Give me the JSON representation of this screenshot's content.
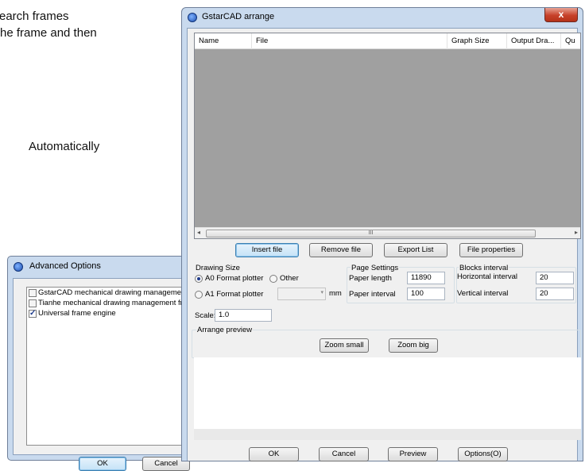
{
  "document": {
    "lines": [
      "earch frames",
      "he frame and then",
      "Automatically"
    ]
  },
  "advanced_options": {
    "title": "Advanced Options",
    "engines": [
      {
        "label": "GstarCAD mechanical drawing management",
        "checked": false
      },
      {
        "label": "Tianhe mechanical drawing management fra",
        "checked": false
      },
      {
        "label": "Universal frame engine",
        "checked": true
      }
    ],
    "ok_label": "OK",
    "cancel_label": "Cancel"
  },
  "arrange_dialog": {
    "title": "GstarCAD arrange",
    "close_label": "x",
    "columns": [
      "Name",
      "File",
      "Graph Size",
      "Output Dra...",
      "Qu"
    ],
    "scroll_thumb": "III",
    "file_buttons": {
      "insert": "Insert file",
      "remove": "Remove file",
      "export": "Export List",
      "properties": "File properties"
    },
    "drawing_size": {
      "title": "Drawing Size",
      "a0_label": "A0 Format plotter",
      "other_label": "Other",
      "a1_label": "A1 Format plotter",
      "unit": "mm",
      "selected": "A0 Format plotter"
    },
    "page_settings": {
      "title": "Page Settings",
      "paper_length_label": "Paper length",
      "paper_length": "11890",
      "paper_interval_label": "Paper interval",
      "paper_interval": "100"
    },
    "blocks_interval": {
      "title": "Blocks interval",
      "horizontal_label": "Horizontal interval",
      "horizontal": "20",
      "vertical_label": "Vertical interval",
      "vertical": "20"
    },
    "scale_label": "Scale:",
    "scale": "1.0",
    "arrange_preview": {
      "title": "Arrange preview",
      "zoom_small": "Zoom small",
      "zoom_big": "Zoom big"
    },
    "footer": {
      "ok": "OK",
      "cancel": "Cancel",
      "preview": "Preview",
      "options": "Options(O)"
    }
  },
  "colors": {
    "frame": "#c9daee",
    "client": "#f0f0f0",
    "list_bg": "#a0a0a0",
    "close_button": "#c7412a"
  }
}
